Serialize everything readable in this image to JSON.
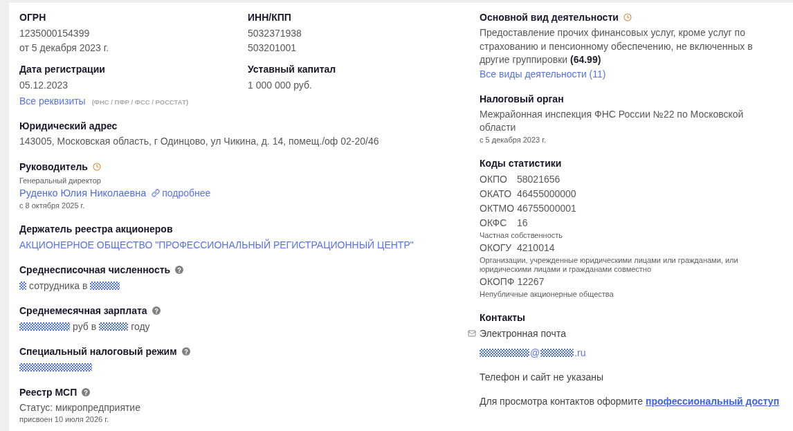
{
  "requisites": {
    "fields": [
      {
        "label": "ОГРН",
        "lines": [
          "1235000154399",
          "от 5 декабря 2023 г."
        ]
      },
      {
        "label": "ИНН/КПП",
        "lines": [
          "5032371938",
          "503201001"
        ]
      },
      {
        "label": "Дата регистрации",
        "lines": [
          "05.12.2023"
        ]
      },
      {
        "label": "Уставный капитал",
        "lines": [
          "1 000 000 руб."
        ]
      }
    ],
    "all_link": "Все реквизиты",
    "sources": "(ФНС / ПФР / ФСС / РОССТАТ)"
  },
  "left_sections": [
    {
      "title": "Юридический адрес",
      "history": false,
      "help": false,
      "items": [
        {
          "kind": "text",
          "text": "143005, Московская область, г Одинцово, ул Чикина, д. 14, помещ./оф 02-20/46"
        }
      ]
    },
    {
      "title": "Руководитель",
      "history": true,
      "help": false,
      "items": [
        {
          "kind": "note",
          "text": "Генеральный директор"
        },
        {
          "kind": "person",
          "name": "Руденко Юлия Николаевна",
          "more": "подробнее"
        },
        {
          "kind": "note",
          "text": "с 8 октября 2025 г."
        }
      ]
    },
    {
      "title": "Держатель реестра акционеров",
      "history": false,
      "help": false,
      "items": [
        {
          "kind": "link",
          "text": "АКЦИОНЕРНОЕ ОБЩЕСТВО \"ПРОФЕССИОНАЛЬНЫЙ РЕГИСТРАЦИОННЫЙ ЦЕНТР\""
        }
      ]
    },
    {
      "title": "Среднесписочная численность",
      "history": false,
      "help": true,
      "items": [
        {
          "kind": "masked",
          "parts": [
            {
              "kind": "mask"
            },
            {
              "kind": "text",
              "text": "сотрудника в"
            },
            {
              "kind": "mask"
            }
          ]
        }
      ]
    },
    {
      "title": "Среднемесячная зарплата",
      "history": false,
      "help": true,
      "items": [
        {
          "kind": "masked",
          "parts": [
            {
              "kind": "mask"
            },
            {
              "kind": "text",
              "text": "руб в"
            },
            {
              "kind": "mask"
            },
            {
              "kind": "text",
              "text": "году"
            }
          ]
        }
      ]
    },
    {
      "title": "Специальный налоговый режим",
      "history": false,
      "help": true,
      "items": [
        {
          "kind": "masked",
          "parts": [
            {
              "kind": "mask"
            }
          ]
        }
      ]
    },
    {
      "title": "Реестр МСП",
      "history": false,
      "help": true,
      "items": [
        {
          "kind": "text",
          "text": "Статус: микропредприятие"
        },
        {
          "kind": "note",
          "text": "присвоен 10 июля 2026 г."
        }
      ]
    }
  ],
  "right_sections": [
    {
      "title": "Основной вид деятельности",
      "history": true,
      "help": false,
      "items": [
        {
          "kind": "text",
          "text": "Предоставление прочих финансовых услуг, кроме услуг по страхованию и пенсионному обеспечению, не включенных в другие группировки **(64.99)**"
        },
        {
          "kind": "link",
          "text": "Все виды деятельности (11)"
        }
      ]
    },
    {
      "title": "Налоговый орган",
      "history": false,
      "help": false,
      "items": [
        {
          "kind": "text",
          "text": "Межрайонная инспекция ФНС России №22 по Московской области"
        },
        {
          "kind": "note",
          "text": "с 5 декабря 2023 г."
        }
      ]
    },
    {
      "title": "Коды статистики",
      "history": false,
      "help": false,
      "items": [
        {
          "kind": "code",
          "code": "ОКПО",
          "value": "58021656"
        },
        {
          "kind": "code",
          "code": "ОКАТО",
          "value": "46455000000"
        },
        {
          "kind": "code",
          "code": "ОКТМО",
          "value": "46755000001"
        },
        {
          "kind": "code",
          "code": "ОКФС",
          "value": "16"
        },
        {
          "kind": "note",
          "text": "Частная собственность"
        },
        {
          "kind": "code",
          "code": "ОКОГУ",
          "value": "4210014"
        },
        {
          "kind": "note",
          "text": "Организации, учрежденные юридическими лицами или гражданами, или юридическими лицами и гражданами совместно"
        },
        {
          "kind": "code",
          "code": "ОКОПФ",
          "value": "12267"
        },
        {
          "kind": "note",
          "text": "Непубличные акционерные общества"
        }
      ]
    },
    {
      "title": "Контакты",
      "history": false,
      "help": false,
      "items": [
        {
          "kind": "channel",
          "label": "Электронная почта"
        },
        {
          "kind": "email",
          "parts": [
            {
              "kind": "mask"
            },
            {
              "kind": "text",
              "text": "@"
            },
            {
              "kind": "mask"
            },
            {
              "kind": "text",
              "text": ".ru"
            }
          ]
        },
        {
          "kind": "message",
          "text": "Телефон и сайт не указаны"
        },
        {
          "kind": "cta",
          "text": "Для просмотра контактов оформите",
          "link": "профессиональный доступ"
        }
      ]
    }
  ]
}
